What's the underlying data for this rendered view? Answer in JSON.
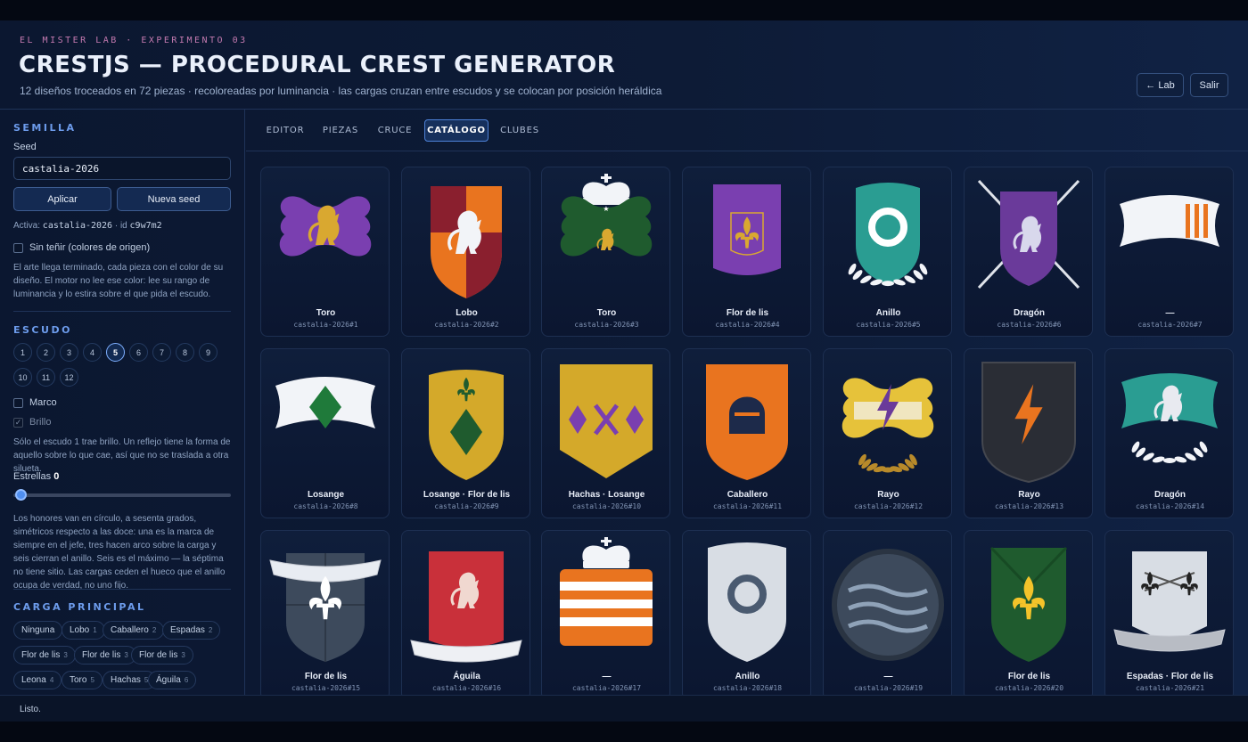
{
  "header": {
    "eyebrow": "EL MISTER LAB · EXPERIMENTO 03",
    "title": "CRESTJS — PROCEDURAL CREST GENERATOR",
    "subtitle": "12 diseños troceados en 72 piezas · recoloreadas por luminancia · las cargas cruzan entre escudos y se colocan por posición heráldica",
    "back_label": "← Lab",
    "exit_label": "Salir"
  },
  "sidebar": {
    "seed_section": "SEMILLA",
    "seed_label": "Seed",
    "seed_value": "castalia-2026",
    "apply_label": "Aplicar",
    "new_seed_label": "Nueva seed",
    "active_prefix": "Activa: ",
    "active_seed": "castalia-2026",
    "active_sep": " · id ",
    "active_id": "c9w7m2",
    "no_tint_label": "Sin teñir (colores de origen)",
    "tint_help": "El arte llega terminado, cada pieza con el color de su diseño. El motor no lee ese color: lee su rango de luminancia y lo estira sobre el que pida el escudo.",
    "shield_section": "ESCUDO",
    "shield_numbers": [
      "1",
      "2",
      "3",
      "4",
      "5",
      "6",
      "7",
      "8",
      "9",
      "10",
      "11",
      "12"
    ],
    "shield_selected": "5",
    "frame_label": "Marco",
    "shine_label": "Brillo",
    "shine_help": "Sólo el escudo 1 trae brillo. Un reflejo tiene la forma de aquello sobre lo que cae, así que no se traslada a otra silueta.",
    "stars_label": "Estrellas",
    "stars_value": "0",
    "stars_help": "Los honores van en círculo, a sesenta grados, simétricos respecto a las doce: una es la marca de siempre en el jefe, tres hacen arco sobre la carga y seis cierran el anillo. Seis es el máximo — la séptima no tiene sitio. Las cargas ceden el hueco que el anillo ocupa de verdad, no uno fijo.",
    "charge_section": "CARGA PRINCIPAL",
    "charges": [
      {
        "label": "Ninguna",
        "count": ""
      },
      {
        "label": "Lobo",
        "count": "1"
      },
      {
        "label": "Caballero",
        "count": "2"
      },
      {
        "label": "Espadas",
        "count": "2"
      },
      {
        "label": "Flor de lis",
        "count": "3"
      },
      {
        "label": "Flor de lis",
        "count": "3"
      },
      {
        "label": "Flor de lis",
        "count": "3"
      },
      {
        "label": "Leona",
        "count": "4"
      },
      {
        "label": "Toro",
        "count": "5"
      },
      {
        "label": "Hachas",
        "count": "5"
      },
      {
        "label": "Águila",
        "count": "6"
      }
    ]
  },
  "tabs": [
    {
      "label": "EDITOR"
    },
    {
      "label": "PIEZAS"
    },
    {
      "label": "CRUCE"
    },
    {
      "label": "CATÁLOGO"
    },
    {
      "label": "CLUBES"
    }
  ],
  "active_tab": "CATÁLOGO",
  "catalog": [
    {
      "name": "Toro",
      "id": "castalia-2026#1",
      "color": "#7a3fb0",
      "charge": "lion-icon"
    },
    {
      "name": "Lobo",
      "id": "castalia-2026#2",
      "color": "#e9741f",
      "charge": "wolf-icon"
    },
    {
      "name": "Toro",
      "id": "castalia-2026#3",
      "color": "#1f5b2e",
      "charge": "bull-icon"
    },
    {
      "name": "Flor de lis",
      "id": "castalia-2026#4",
      "color": "#7a3fb0",
      "charge": "fleur-de-lis-icon"
    },
    {
      "name": "Anillo",
      "id": "castalia-2026#5",
      "color": "#2a9d92",
      "charge": "ring-icon"
    },
    {
      "name": "Dragón",
      "id": "castalia-2026#6",
      "color": "#6a3a9a",
      "charge": "dragon-icon"
    },
    {
      "name": "—",
      "id": "castalia-2026#7",
      "color": "#f4f6fa",
      "charge": "pale-stripes-icon"
    },
    {
      "name": "Losange",
      "id": "castalia-2026#8",
      "color": "#f4f6fa",
      "charge": "lozenge-icon"
    },
    {
      "name": "Losange · Flor de lis",
      "id": "castalia-2026#9",
      "color": "#d4a92a",
      "charge": "lozenge-fleur-icon"
    },
    {
      "name": "Hachas · Losange",
      "id": "castalia-2026#10",
      "color": "#d4a92a",
      "charge": "axes-icon"
    },
    {
      "name": "Caballero",
      "id": "castalia-2026#11",
      "color": "#e9741f",
      "charge": "knight-helm-icon"
    },
    {
      "name": "Rayo",
      "id": "castalia-2026#12",
      "color": "#e6c23a",
      "charge": "lightning-icon"
    },
    {
      "name": "Rayo",
      "id": "castalia-2026#13",
      "color": "#2a2d35",
      "charge": "lightning-icon"
    },
    {
      "name": "Dragón",
      "id": "castalia-2026#14",
      "color": "#2a9d92",
      "charge": "dragon-icon"
    },
    {
      "name": "Flor de lis",
      "id": "castalia-2026#15",
      "color": "#3d4a5c",
      "charge": "fleur-de-lis-icon"
    },
    {
      "name": "Águila",
      "id": "castalia-2026#16",
      "color": "#c9303a",
      "charge": "eagle-icon"
    },
    {
      "name": "—",
      "id": "castalia-2026#17",
      "color": "#e9741f",
      "charge": "stripes-icon"
    },
    {
      "name": "Anillo",
      "id": "castalia-2026#18",
      "color": "#d8dde4",
      "charge": "ring-icon"
    },
    {
      "name": "—",
      "id": "castalia-2026#19",
      "color": "#3d4a5c",
      "charge": "waves-icon"
    },
    {
      "name": "Flor de lis",
      "id": "castalia-2026#20",
      "color": "#1f5b2e",
      "charge": "fleur-de-lis-icon"
    },
    {
      "name": "Espadas · Flor de lis",
      "id": "castalia-2026#21",
      "color": "#d8dde4",
      "charge": "swords-fleur-icon"
    }
  ],
  "status": "Listo."
}
